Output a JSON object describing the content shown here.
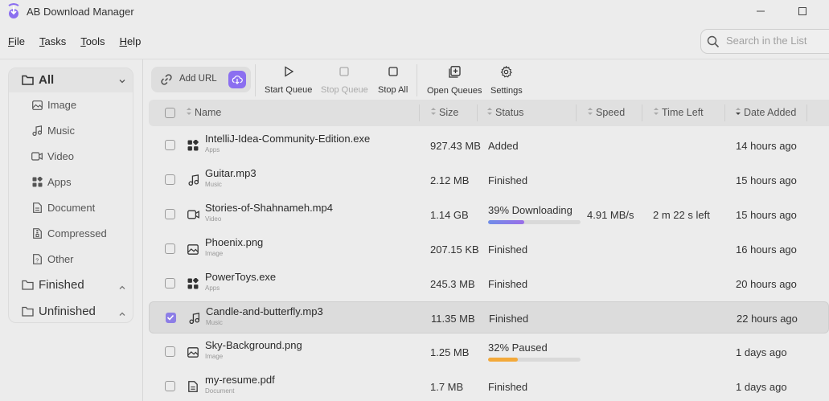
{
  "app": {
    "title": "AB Download Manager",
    "accent_color": "#8b6ff0",
    "logo_icon": "download-arrow-logo"
  },
  "menu": [
    {
      "label": "File",
      "mnemonic": "F",
      "rest": "ile"
    },
    {
      "label": "Tasks",
      "mnemonic": "T",
      "rest": "asks"
    },
    {
      "label": "Tools",
      "mnemonic": "T",
      "rest": "ools"
    },
    {
      "label": "Help",
      "mnemonic": "H",
      "rest": "elp"
    }
  ],
  "search": {
    "placeholder": "Search in the List"
  },
  "sidebar": {
    "all_label": "All",
    "categories": [
      {
        "label": "Image",
        "icon": "image-icon"
      },
      {
        "label": "Music",
        "icon": "music-icon"
      },
      {
        "label": "Video",
        "icon": "video-icon"
      },
      {
        "label": "Apps",
        "icon": "apps-icon"
      },
      {
        "label": "Document",
        "icon": "document-icon"
      },
      {
        "label": "Compressed",
        "icon": "compressed-icon"
      },
      {
        "label": "Other",
        "icon": "other-icon"
      }
    ],
    "finished_label": "Finished",
    "unfinished_label": "Unfinished"
  },
  "toolbar": {
    "add_url": "Add URL",
    "start_queue": "Start Queue",
    "stop_queue": "Stop Queue",
    "stop_all": "Stop All",
    "open_queues": "Open Queues",
    "settings": "Settings"
  },
  "table": {
    "columns": {
      "name": "Name",
      "size": "Size",
      "status": "Status",
      "speed": "Speed",
      "time_left": "Time Left",
      "date_added": "Date Added"
    },
    "rows": [
      {
        "name": "IntelliJ-Idea-Community-Edition.exe",
        "type": "Apps",
        "size": "927.43 MB",
        "status": "Added",
        "speed": "",
        "time_left": "",
        "date": "14 hours ago",
        "checked": false
      },
      {
        "name": "Guitar.mp3",
        "type": "Music",
        "size": "2.12 MB",
        "status": "Finished",
        "speed": "",
        "time_left": "",
        "date": "15 hours ago",
        "checked": false
      },
      {
        "name": "Stories-of-Shahnameh.mp4",
        "type": "Video",
        "size": "1.14 GB",
        "status": "39% Downloading",
        "progress": 0.39,
        "speed": "4.91 MB/s",
        "time_left": "2 m 22 s left",
        "date": "15 hours ago",
        "checked": false
      },
      {
        "name": "Phoenix.png",
        "type": "Image",
        "size": "207.15 KB",
        "status": "Finished",
        "speed": "",
        "time_left": "",
        "date": "16 hours ago",
        "checked": false
      },
      {
        "name": "PowerToys.exe",
        "type": "Apps",
        "size": "245.3 MB",
        "status": "Finished",
        "speed": "",
        "time_left": "",
        "date": "20 hours ago",
        "checked": false
      },
      {
        "name": "Candle-and-butterfly.mp3",
        "type": "Music",
        "size": "11.35 MB",
        "status": "Finished",
        "speed": "",
        "time_left": "",
        "date": "22 hours ago",
        "checked": true
      },
      {
        "name": "Sky-Background.png",
        "type": "Image",
        "size": "1.25 MB",
        "status": "32% Paused",
        "progress": 0.32,
        "speed": "",
        "time_left": "",
        "date": "1 days ago",
        "checked": false
      },
      {
        "name": "my-resume.pdf",
        "type": "Document",
        "size": "1.7 MB",
        "status": "Finished",
        "speed": "",
        "time_left": "",
        "date": "1 days ago",
        "checked": false
      }
    ]
  }
}
